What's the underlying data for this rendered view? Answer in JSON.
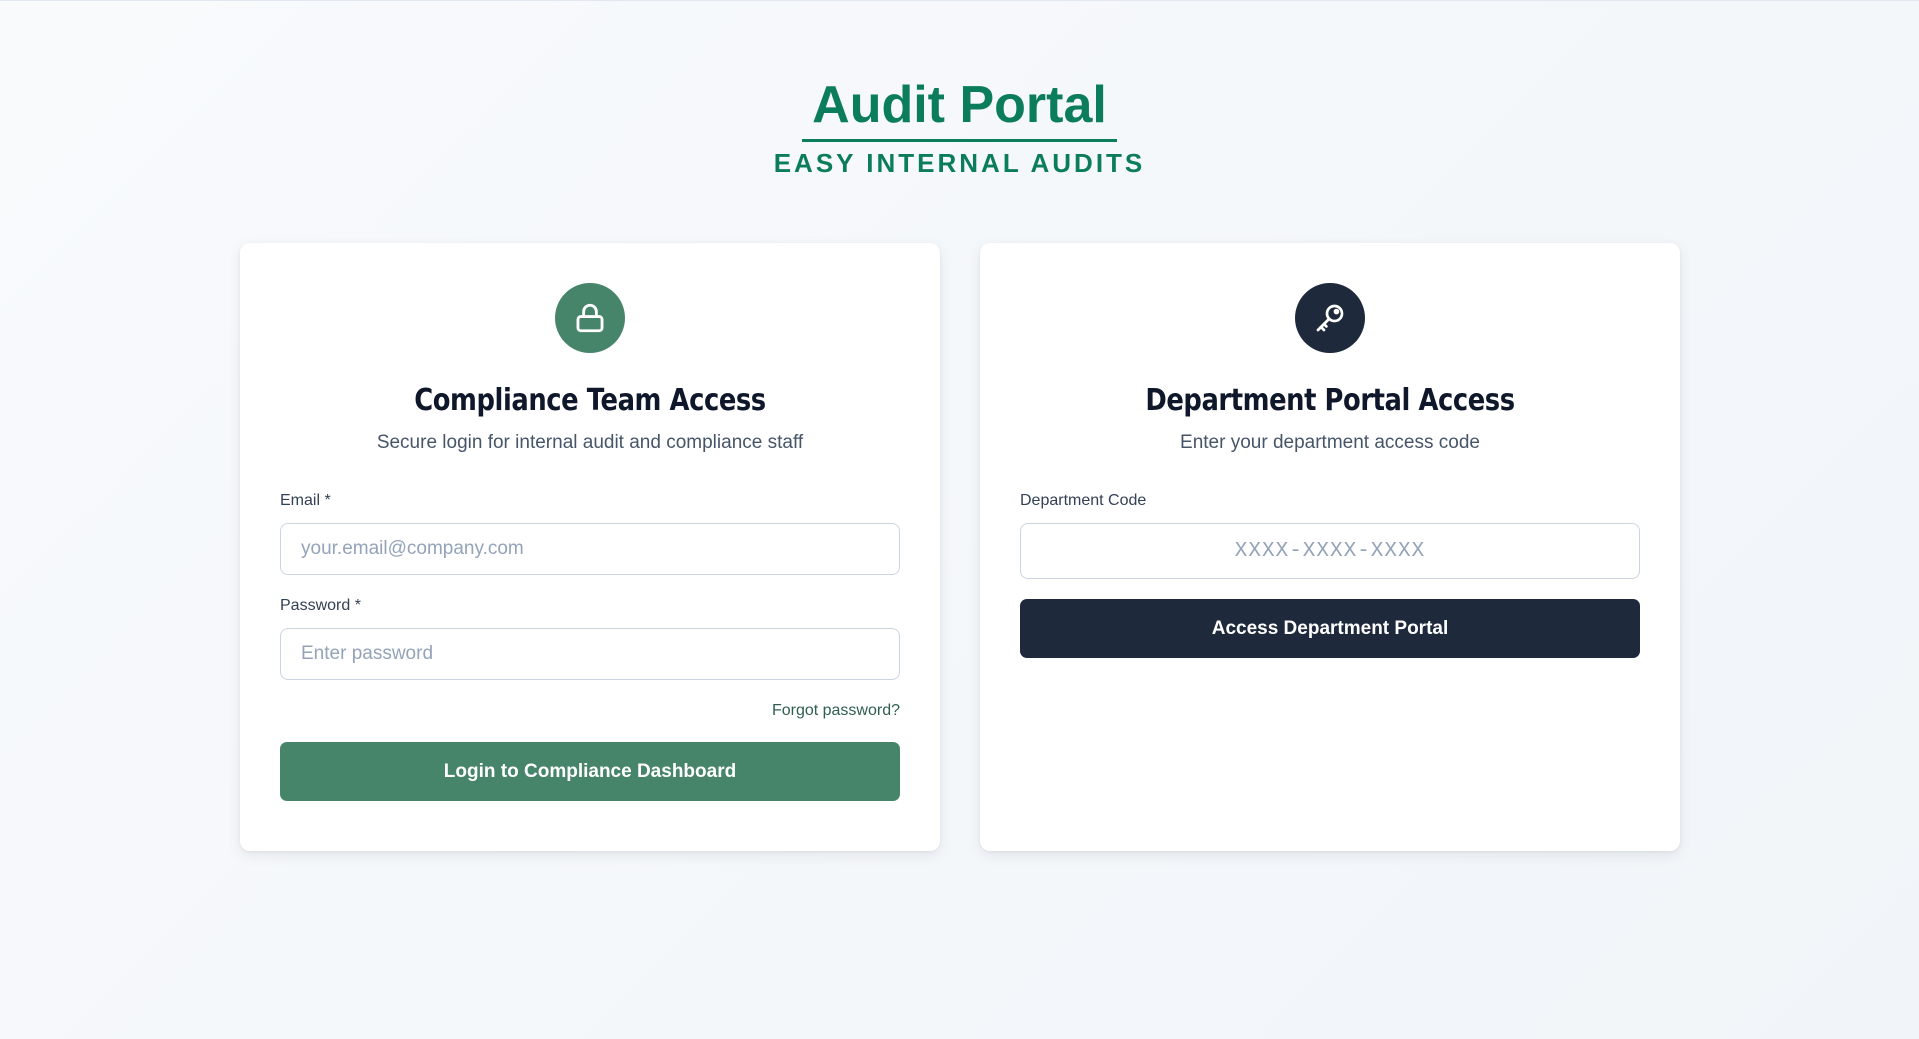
{
  "brand": {
    "title": "Audit Portal",
    "subtitle": "EASY INTERNAL AUDITS",
    "color": "#0b7c5c"
  },
  "compliance": {
    "icon": "lock-icon",
    "title": "Compliance Team Access",
    "description": "Secure login for internal audit and compliance staff",
    "email_label": "Email *",
    "email_value": "",
    "email_placeholder": "your.email@company.com",
    "password_label": "Password *",
    "password_value": "",
    "password_placeholder": "Enter password",
    "forgot_label": "Forgot password?",
    "submit_label": "Login to Compliance Dashboard",
    "accent": "#47856b"
  },
  "department": {
    "icon": "key-icon",
    "title": "Department Portal Access",
    "description": "Enter your department access code",
    "code_label": "Department Code",
    "code_value": "",
    "code_placeholder": "XXXX-XXXX-XXXX",
    "submit_label": "Access Department Portal",
    "accent": "#1e293b"
  }
}
